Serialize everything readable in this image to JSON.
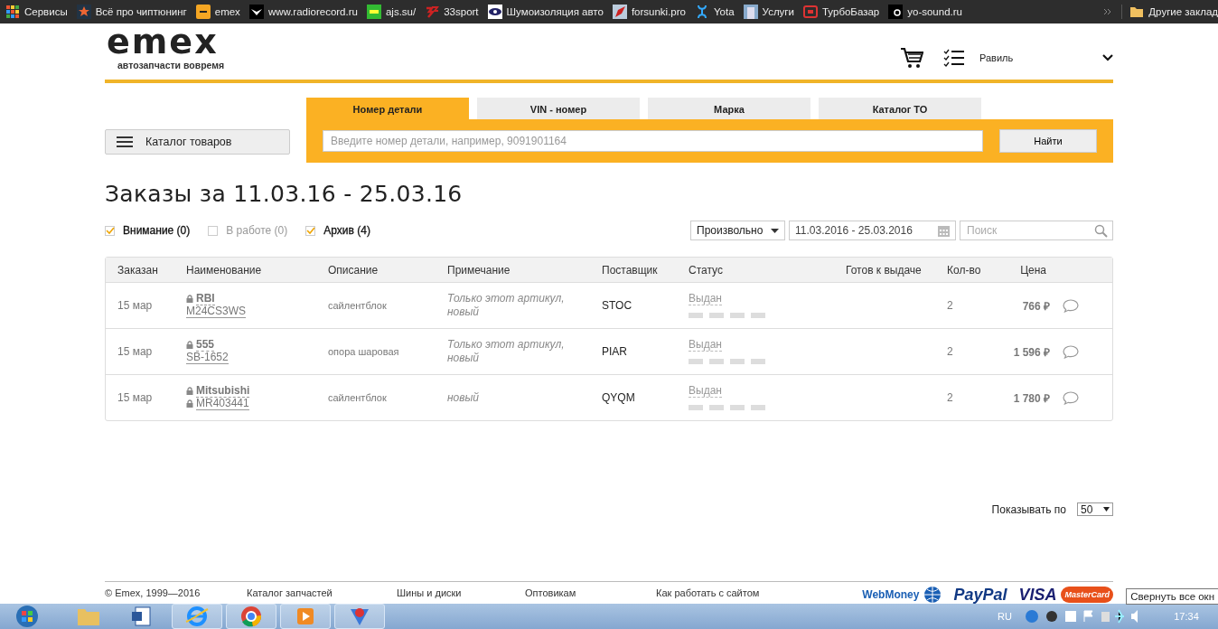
{
  "bookmarks": [
    {
      "label": "Сервисы"
    },
    {
      "label": "Всё про чиптюнинг"
    },
    {
      "label": "emex"
    },
    {
      "label": "www.radiorecord.ru"
    },
    {
      "label": "ajs.su/"
    },
    {
      "label": "33sport"
    },
    {
      "label": "Шумоизоляция авто"
    },
    {
      "label": "forsunki.pro"
    },
    {
      "label": "Yota"
    },
    {
      "label": "Услуги"
    },
    {
      "label": "ТурбоБазар"
    },
    {
      "label": "yo-sound.ru"
    }
  ],
  "other_bookmarks": "Другие заклад",
  "logo": {
    "text": "emex",
    "tagline": "автозапчасти вовремя"
  },
  "user": {
    "name": "Равиль"
  },
  "catalog_button": "Каталог товаров",
  "search_tabs": [
    {
      "label": "Номер детали",
      "selected": true
    },
    {
      "label": "VIN - номер",
      "selected": false
    },
    {
      "label": "Марка",
      "selected": false
    },
    {
      "label": "Каталог ТО",
      "selected": false
    }
  ],
  "search": {
    "placeholder": "Введите номер детали, например, 9091901164",
    "button": "Найти"
  },
  "page_title": "Заказы за 11.03.16 - 25.03.16",
  "filters": [
    {
      "label": "Внимание (0)",
      "checked": true
    },
    {
      "label": "В работе (0)",
      "checked": false
    },
    {
      "label": "Архив (4)",
      "checked": true
    }
  ],
  "period": {
    "value": "Произвольно",
    "dates": "11.03.2016 - 25.03.2016",
    "search_placeholder": "Поиск"
  },
  "table": {
    "columns": [
      "Заказан",
      "Наименование",
      "Описание",
      "Примечание",
      "Поставщик",
      "Статус",
      "Готов к выдаче",
      "Кол-во",
      "Цена"
    ],
    "rows": [
      {
        "ordered": "15 мар",
        "brand": "RBI",
        "brand_locked": true,
        "article": "M24CS3WS",
        "article_locked": false,
        "description": "сайлентблок",
        "note": "Только этот артикул, новый",
        "supplier": "STOC",
        "status": "Выдан",
        "quantity": "2",
        "price": "766 ₽"
      },
      {
        "ordered": "15 мар",
        "brand": "555",
        "brand_locked": true,
        "article": "SB-1652",
        "article_locked": false,
        "description": "опора шаровая",
        "note": "Только этот артикул, новый",
        "supplier": "PIAR",
        "status": "Выдан",
        "quantity": "2",
        "price": "1 596 ₽"
      },
      {
        "ordered": "15 мар",
        "brand": "Mitsubishi",
        "brand_locked": true,
        "article": "MR403441",
        "article_locked": true,
        "description": "сайлентблок",
        "note": "новый",
        "supplier": "QYQM",
        "status": "Выдан",
        "quantity": "2",
        "price": "1 780 ₽"
      }
    ]
  },
  "page_size": {
    "label": "Показывать по",
    "value": "50"
  },
  "footer": {
    "copyright": "© Emex, 1999—2016",
    "links": [
      "Каталог запчастей",
      "Шины и диски",
      "Оптовикам",
      "Как работать с сайтом"
    ],
    "payments": [
      "WebMoney",
      "PayPal",
      "VISA",
      "MasterCard"
    ]
  },
  "tooltip": "Свернуть все окн",
  "taskbar": {
    "apps": [
      {
        "active": false
      },
      {
        "active": false
      },
      {
        "active": true
      },
      {
        "active": true
      },
      {
        "active": true
      },
      {
        "active": true
      }
    ],
    "language": "RU",
    "time": "17:34"
  }
}
